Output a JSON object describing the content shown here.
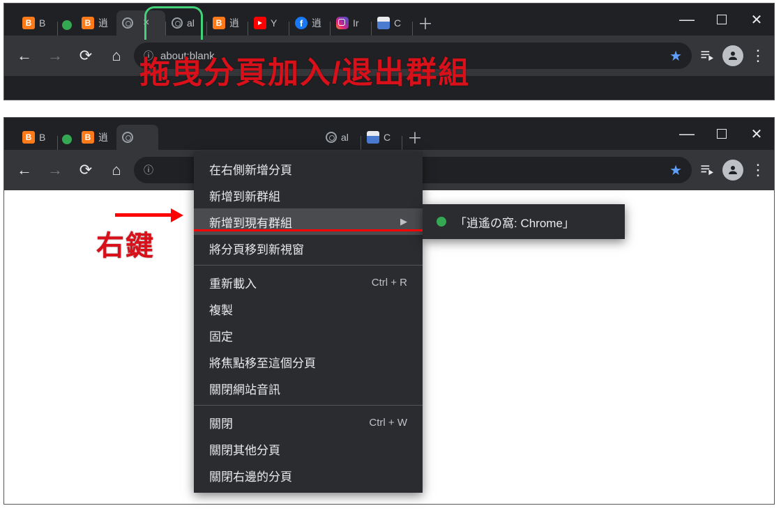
{
  "annotations": {
    "drag_text": "拖曳分頁加入/退出群組",
    "right_click_label": "右鍵"
  },
  "window1": {
    "address": "about:blank",
    "tabs": [
      {
        "label": "B",
        "icon": "blogger"
      },
      {
        "group_dot": true
      },
      {
        "label": "逍",
        "icon": "blogger"
      },
      {
        "label": "",
        "icon": "globe",
        "active": true
      },
      {
        "label": "al",
        "icon": "globe"
      },
      {
        "label": "逍",
        "icon": "blogger"
      },
      {
        "label": "Y",
        "icon": "youtube"
      },
      {
        "label": "逍",
        "icon": "facebook"
      },
      {
        "label": "Ir",
        "icon": "instagram"
      },
      {
        "label": "C",
        "icon": "store"
      }
    ]
  },
  "window2": {
    "tabs": [
      {
        "label": "B",
        "icon": "blogger"
      },
      {
        "group_dot": true
      },
      {
        "label": "逍",
        "icon": "blogger"
      },
      {
        "label": "",
        "icon": "globe",
        "active_rc": true
      },
      {
        "label": "al",
        "icon": "globe"
      },
      {
        "label": "C",
        "icon": "store"
      }
    ]
  },
  "context_menu": {
    "items": [
      {
        "label": "在右側新增分頁"
      },
      {
        "label": "新增到新群組"
      },
      {
        "label": "新增到現有群組",
        "submenu": true,
        "highlight": true
      },
      {
        "label": "將分頁移到新視窗"
      },
      {
        "sep": true
      },
      {
        "label": "重新載入",
        "shortcut": "Ctrl + R"
      },
      {
        "label": "複製"
      },
      {
        "label": "固定"
      },
      {
        "label": "將焦點移至這個分頁"
      },
      {
        "label": "關閉網站音訊"
      },
      {
        "sep": true
      },
      {
        "label": "關閉",
        "shortcut": "Ctrl + W"
      },
      {
        "label": "關閉其他分頁"
      },
      {
        "label": "關閉右邊的分頁"
      }
    ],
    "submenu_label": "「逍遙の窩: Chrome」"
  }
}
